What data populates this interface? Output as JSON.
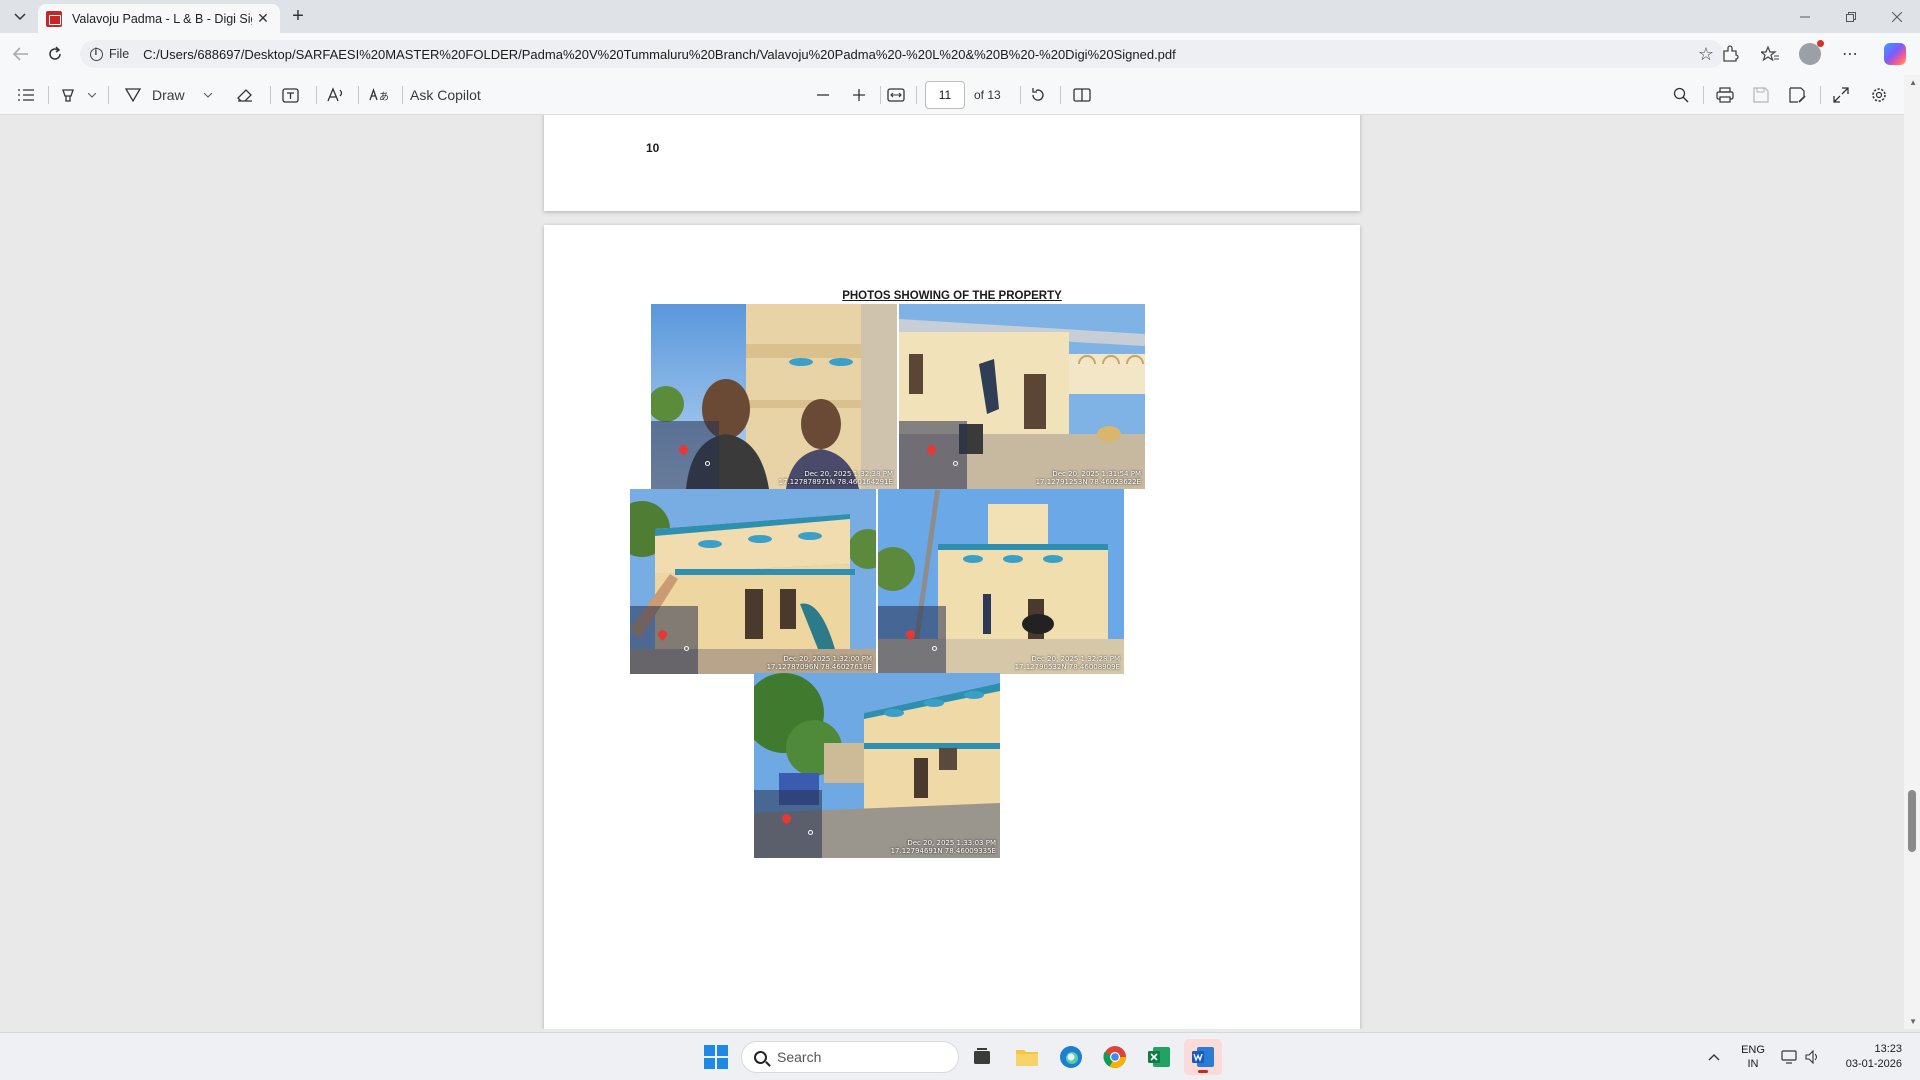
{
  "browser": {
    "tab_title": "Valavoju Padma - L & B - Digi Sig",
    "new_tab_label": "+",
    "site_info_label": "File",
    "url": "C:/Users/688697/Desktop/SARFAESI%20MASTER%20FOLDER/Padma%20V%20Tummaluru%20Branch/Valavoju%20Padma%20-%20L%20&%20B%20-%20Digi%20Signed.pdf"
  },
  "pdf_toolbar": {
    "draw_label": "Draw",
    "ask_copilot_label": "Ask Copilot",
    "current_page": "11",
    "page_of": "of 13"
  },
  "document": {
    "prev_page_number": "10",
    "heading": "PHOTOS SHOWING OF THE PROPERTY",
    "photos": [
      {
        "date": "Dec 20, 2025 1:32:38 PM",
        "coords": "17.127878971N 78.460164291E"
      },
      {
        "date": "Dec 20, 2025 1:31:54 PM",
        "coords": "17.12791253N 78.46023622E"
      },
      {
        "date": "Dec 20, 2025 1:32:00 PM",
        "coords": "17.12787096N 78.46027618E"
      },
      {
        "date": "Dec 20, 2025 1:32:28 PM",
        "coords": "17.12790532N 78.46008909E"
      },
      {
        "date": "Dec 20, 2025 1:33:03 PM",
        "coords": "17.12794691N 78.46009335E"
      }
    ]
  },
  "taskbar": {
    "search_placeholder": "Search",
    "language": "ENG",
    "region": "IN",
    "time": "13:23",
    "date": "03-01-2026"
  }
}
